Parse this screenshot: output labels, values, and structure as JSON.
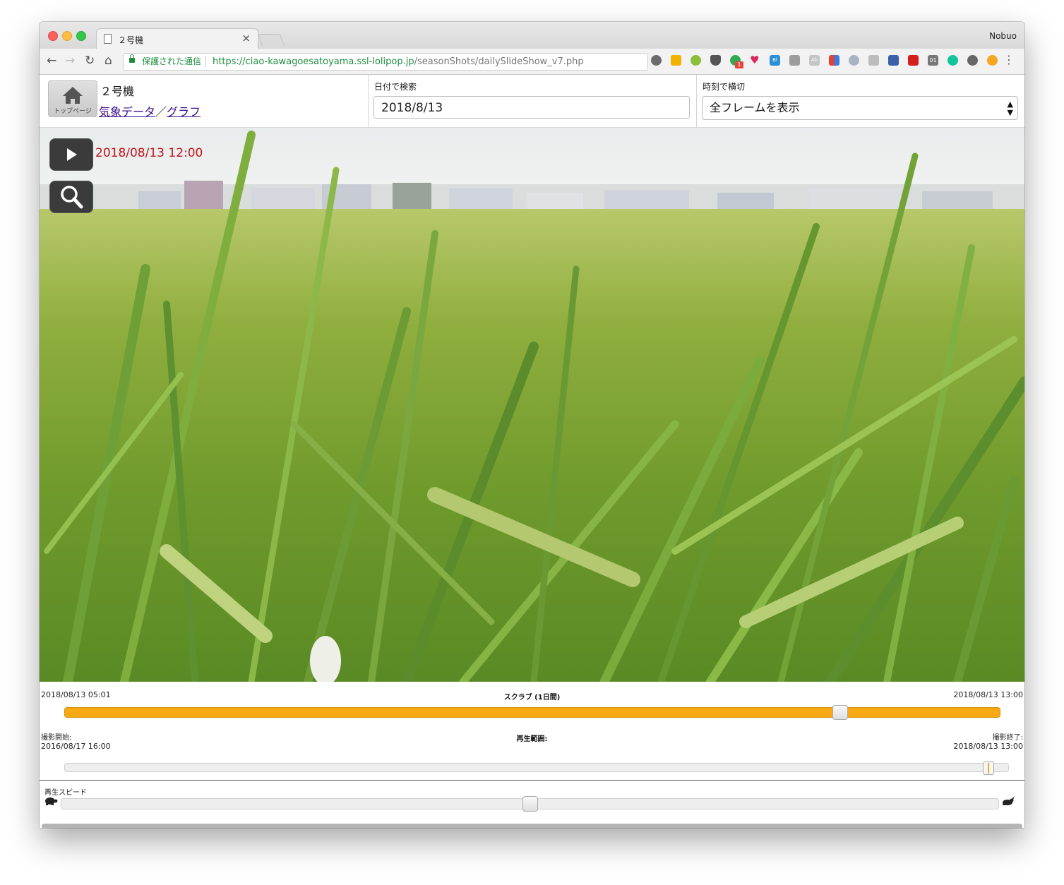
{
  "browser": {
    "tab_title": "２号機",
    "tab_close": "×",
    "profile_name": "Nobuo",
    "secure_label": "保護された通信",
    "url_host": "https://ciao-kawagoesatoyama.ssl-lolipop.jp",
    "url_path": "/seasonShots/dailySlideShow_v7.php",
    "back_icon": "←",
    "forward_icon": "→",
    "reload_icon": "↻",
    "home_icon": "⌂",
    "star_icon": "☆",
    "menu_icon": "⋮",
    "extension_badge": "1",
    "extension_text": [
      "Bl",
      "Ab",
      "01"
    ]
  },
  "header": {
    "home_caption": "トップページ",
    "device_name": "２号機",
    "weather_link": "気象データ",
    "link_separator": "／",
    "graph_link": "グラフ",
    "date_label": "日付で検索",
    "date_value": "2018/8/13",
    "time_label": "時刻で横切",
    "time_select_value": "全フレームを表示"
  },
  "viewer": {
    "timestamp": "2018/08/13 12:00",
    "play_icon": "▶",
    "zoom_icon": "magnifier"
  },
  "scrub": {
    "start": "2018/08/13 05:01",
    "title": "スクラブ (1日間)",
    "end": "2018/08/13 13:00",
    "position": 0.835
  },
  "range": {
    "start_label": "撮影開始:",
    "start_value": "2016/08/17 16:00",
    "title": "再生範囲:",
    "end_label": "撮影終了:",
    "end_value": "2018/08/13 13:00",
    "position": 0.985
  },
  "speed": {
    "label": "再生スピード",
    "slow_icon": "turtle-icon",
    "fast_icon": "rabbit-icon",
    "position": 0.5
  }
}
